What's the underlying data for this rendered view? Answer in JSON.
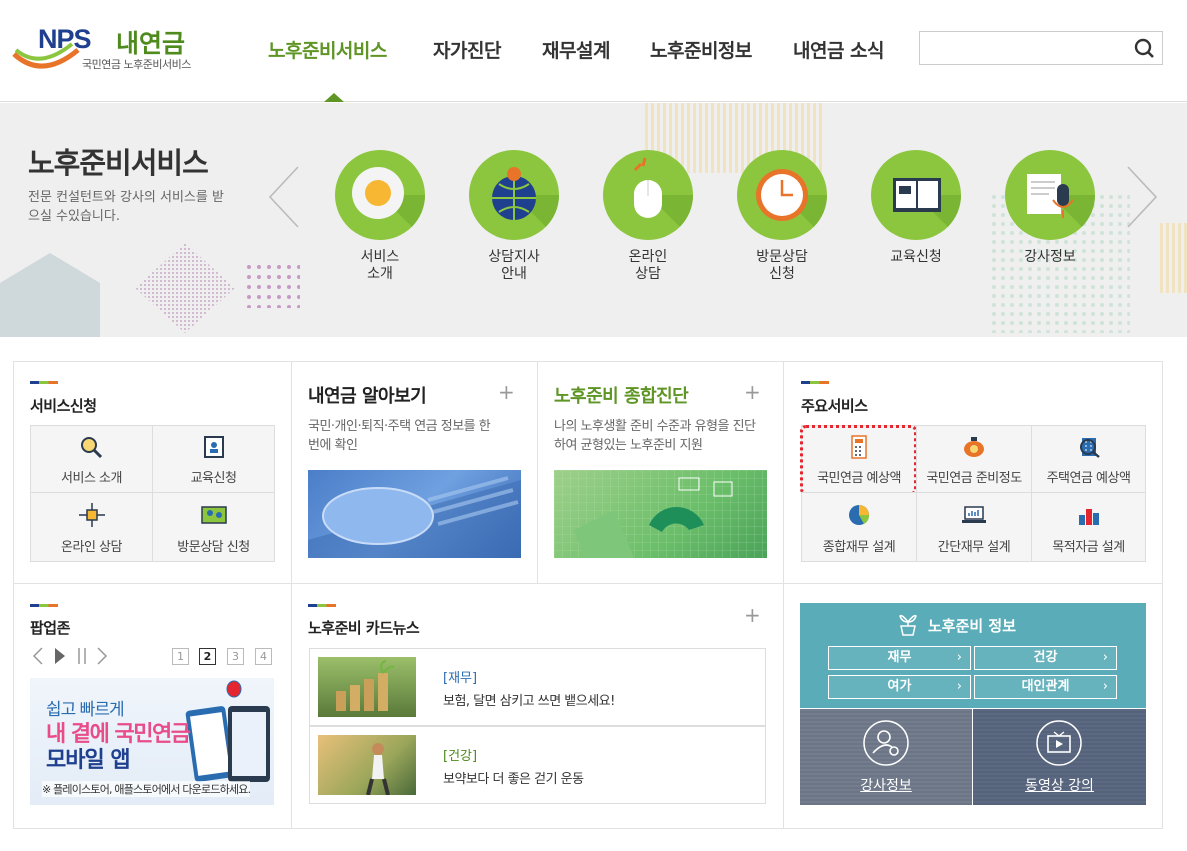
{
  "header": {
    "logo_nps": "NPS",
    "logo_my": "내연금",
    "logo_sub": "국민연금 노후준비서비스",
    "nav": [
      "노후준비서비스",
      "자가진단",
      "재무설계",
      "노후준비정보",
      "내연금 소식"
    ],
    "search_placeholder": ""
  },
  "hero": {
    "title": "노후준비서비스",
    "desc": "전문 컨설턴트와 강사의 서비스를 받으실 수있습니다.",
    "items": [
      {
        "label": "서비스\n소개",
        "icon": "egg-plate-icon"
      },
      {
        "label": "상담지사\n안내",
        "icon": "globe-pin-icon"
      },
      {
        "label": "온라인\n상담",
        "icon": "mouse-icon"
      },
      {
        "label": "방문상담\n신청",
        "icon": "clock-icon"
      },
      {
        "label": "교육신청",
        "icon": "book-icon"
      },
      {
        "label": "강사정보",
        "icon": "microphone-icon"
      }
    ]
  },
  "service_apply": {
    "title": "서비스신청",
    "items": [
      "서비스 소개",
      "교육신청",
      "온라인 상담",
      "방문상담 신청"
    ]
  },
  "my_pension": {
    "title": "내연금 알아보기",
    "desc": "국민·개인·퇴직·주택 연금 정보를 한 번에 확인"
  },
  "diagnosis": {
    "title": "노후준비 종합진단",
    "desc": "나의 노후생활 준비 수준과 유형을 진단하여 균형있는 노후준비 지원"
  },
  "main_services": {
    "title": "주요서비스",
    "items": [
      "국민연금 예상액",
      "국민연금 준비정도",
      "주택연금 예상액",
      "종합재무 설계",
      "간단재무 설계",
      "목적자금 설계"
    ]
  },
  "popup_zone": {
    "title": "팝업존",
    "pages": [
      "1",
      "2",
      "3",
      "4"
    ],
    "current_page": "2",
    "banner_line1": "쉽고 빠르게",
    "banner_line2": "내 곁에 국민연금",
    "banner_line3": "모바일 앱",
    "banner_note": "※ 플레이스토어, 애플스토어에서 다운로드하세요."
  },
  "card_news": {
    "title": "노후준비 카드뉴스",
    "items": [
      {
        "category": "[재무]",
        "text": "보험, 달면 삼키고 쓰면 뱉으세요!"
      },
      {
        "category": "[건강]",
        "text": "보약보다 더 좋은 걷기 운동"
      }
    ]
  },
  "retire_info": {
    "title": "노후준비 정보",
    "buttons": [
      "재무",
      "건강",
      "여가",
      "대인관계"
    ],
    "lecturer": "강사정보",
    "video": "동영상 강의"
  },
  "colors": {
    "green": "#5e9524",
    "navy": "#1f3f8f",
    "teal": "#5aadb8",
    "slate": "#6f7a8c"
  }
}
